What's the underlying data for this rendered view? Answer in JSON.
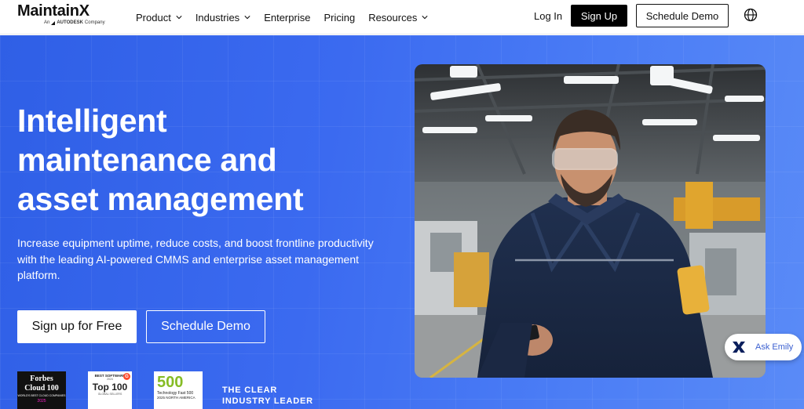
{
  "brand": {
    "name_part1": "Maintain",
    "name_x": "X",
    "sub_prefix": "An",
    "sub_company": "AUTODESK",
    "sub_suffix": "Company"
  },
  "nav": {
    "menu": [
      {
        "label": "Product",
        "has_dropdown": true
      },
      {
        "label": "Industries",
        "has_dropdown": true
      },
      {
        "label": "Enterprise",
        "has_dropdown": false
      },
      {
        "label": "Pricing",
        "has_dropdown": false
      },
      {
        "label": "Resources",
        "has_dropdown": true
      }
    ],
    "login_label": "Log In",
    "signup_label": "Sign Up",
    "demo_label": "Schedule Demo",
    "globe_icon": "globe-icon"
  },
  "hero": {
    "headline_line1": "Intelligent",
    "headline_line2": "maintenance and",
    "headline_line3": "asset management",
    "subcopy": "Increase equipment uptime, reduce costs, and boost frontline productivity with the leading AI-powered CMMS and enterprise asset management platform.",
    "cta_primary": "Sign up for Free",
    "cta_secondary": "Schedule Demo",
    "leader_line1": "THE CLEAR",
    "leader_line2": "INDUSTRY LEADER"
  },
  "badges": {
    "forbes": {
      "brand": "Forbes",
      "title": "Cloud 100",
      "desc": "WORLD'S BEST CLOUD COMPANIES",
      "year": "2025"
    },
    "g2": {
      "top": "BEST SOFTWARE",
      "year": "2024",
      "title": "Top 100",
      "desc": "GLOBAL SELLERS",
      "mark": "G"
    },
    "deloitte": {
      "number": "500",
      "line1": "Technology Fast 500",
      "line2": "2025 NORTH AMERICA"
    }
  },
  "chat": {
    "label": "Ask Emily"
  },
  "colors": {
    "hero_blue": "#3b6af0",
    "black": "#000000",
    "white": "#ffffff"
  }
}
